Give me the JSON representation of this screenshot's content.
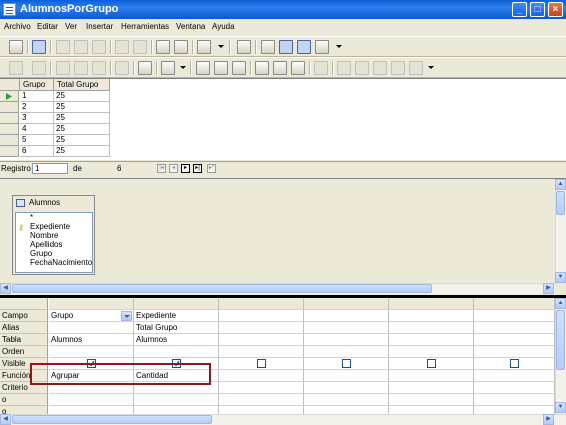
{
  "window": {
    "title": "AlumnosPorGrupo",
    "min": "_",
    "max": "□",
    "close": "×"
  },
  "menu": [
    {
      "label": "Archivo"
    },
    {
      "label": "Editar"
    },
    {
      "label": "Ver"
    },
    {
      "label": "Insertar"
    },
    {
      "label": "Herramientas"
    },
    {
      "label": "Ventana"
    },
    {
      "label": "Ayuda"
    }
  ],
  "results": {
    "columns": [
      "Grupo",
      "Total Grupo"
    ],
    "rows": [
      [
        "1",
        "25"
      ],
      [
        "2",
        "25"
      ],
      [
        "3",
        "25"
      ],
      [
        "4",
        "25"
      ],
      [
        "5",
        "25"
      ],
      [
        "6",
        "25"
      ]
    ]
  },
  "navigator": {
    "label": "Registro",
    "current": "1",
    "of_label": "de",
    "total": "6"
  },
  "table_window": {
    "name": "Alumnos",
    "all_fields": "*",
    "fields": [
      "Expediente",
      "Nombre",
      "Apellidos",
      "Grupo",
      "FechaNacimiento"
    ]
  },
  "query_grid": {
    "row_labels": [
      "Campo",
      "Alias",
      "Tabla",
      "Orden",
      "Visible",
      "Función",
      "Criterio",
      "o",
      "o"
    ],
    "columns": [
      {
        "campo": "Grupo",
        "alias": "",
        "tabla": "Alumnos",
        "visible": true,
        "funcion": "Agrupar"
      },
      {
        "campo": "Expediente",
        "alias": "Total Grupo",
        "tabla": "Alumnos",
        "visible": true,
        "funcion": "Cantidad"
      },
      {
        "campo": "",
        "alias": "",
        "tabla": "",
        "visible": false,
        "funcion": ""
      },
      {
        "campo": "",
        "alias": "",
        "tabla": "",
        "visible": false,
        "funcion": ""
      },
      {
        "campo": "",
        "alias": "",
        "tabla": "",
        "visible": false,
        "funcion": ""
      },
      {
        "campo": "",
        "alias": "",
        "tabla": "",
        "visible": false,
        "funcion": ""
      }
    ]
  },
  "colors": {
    "titlebar": "#0a5fd8",
    "highlight_box": "#8b1a1a",
    "current_row_marker": "#2ea043"
  }
}
